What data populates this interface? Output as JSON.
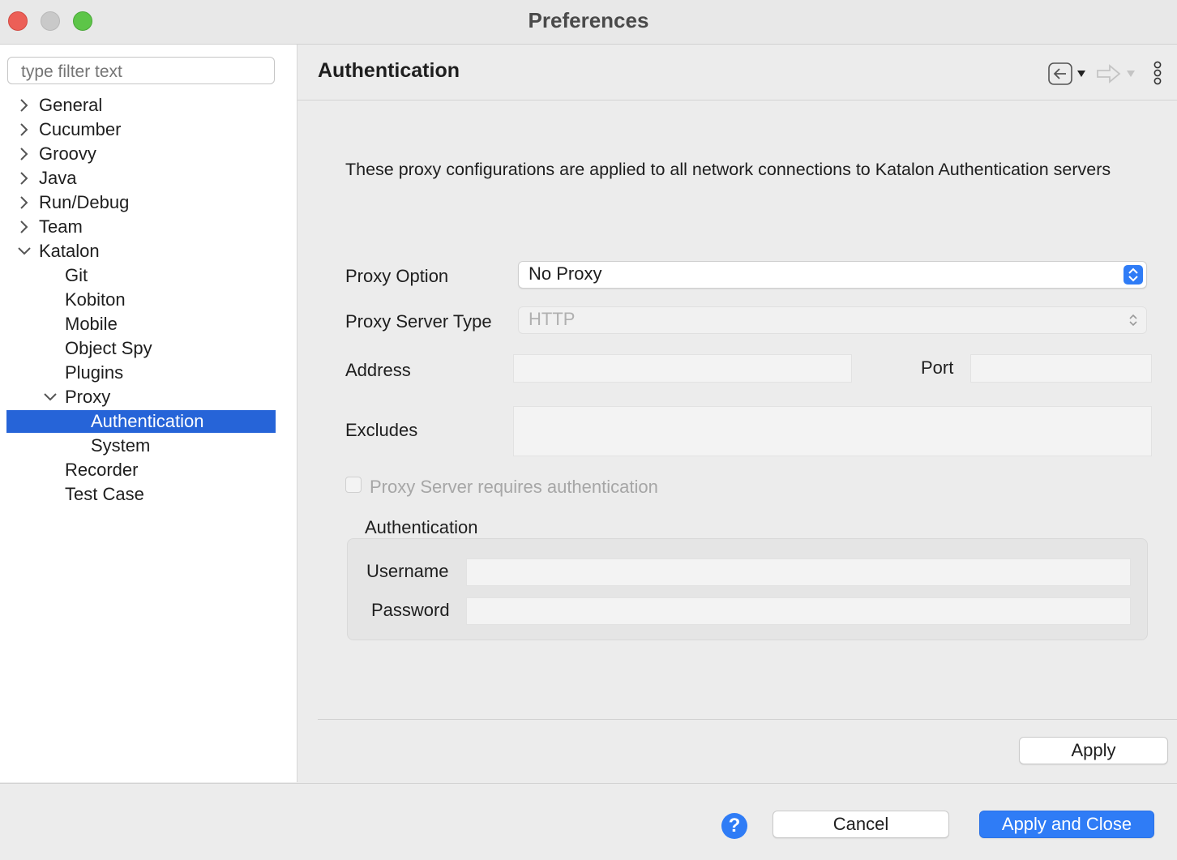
{
  "window": {
    "title": "Preferences"
  },
  "filter": {
    "placeholder": "type filter text"
  },
  "tree": {
    "general": "General",
    "cucumber": "Cucumber",
    "groovy": "Groovy",
    "java": "Java",
    "run_debug": "Run/Debug",
    "team": "Team",
    "katalon": "Katalon",
    "git": "Git",
    "kobiton": "Kobiton",
    "mobile": "Mobile",
    "object_spy": "Object Spy",
    "plugins": "Plugins",
    "proxy": "Proxy",
    "authentication": "Authentication",
    "system": "System",
    "recorder": "Recorder",
    "test_case": "Test Case"
  },
  "page": {
    "title": "Authentication",
    "description": "These proxy configurations are applied to all network connections to Katalon Authentication servers",
    "proxy_option_label": "Proxy Option",
    "proxy_option_value": "No Proxy",
    "proxy_server_type_label": "Proxy Server Type",
    "proxy_server_type_value": "HTTP",
    "address_label": "Address",
    "port_label": "Port",
    "excludes_label": "Excludes",
    "requires_auth_label": "Proxy Server requires authentication",
    "auth_group_title": "Authentication",
    "username_label": "Username",
    "password_label": "Password",
    "apply_label": "Apply"
  },
  "footer": {
    "help_glyph": "?",
    "cancel_label": "Cancel",
    "apply_close_label": "Apply and Close"
  },
  "colors": {
    "selection": "#2664d8",
    "primary_button": "#2f7cf6",
    "close": "#ec5f57",
    "minimize": "#c9c9c9",
    "maximize": "#5dc548"
  }
}
